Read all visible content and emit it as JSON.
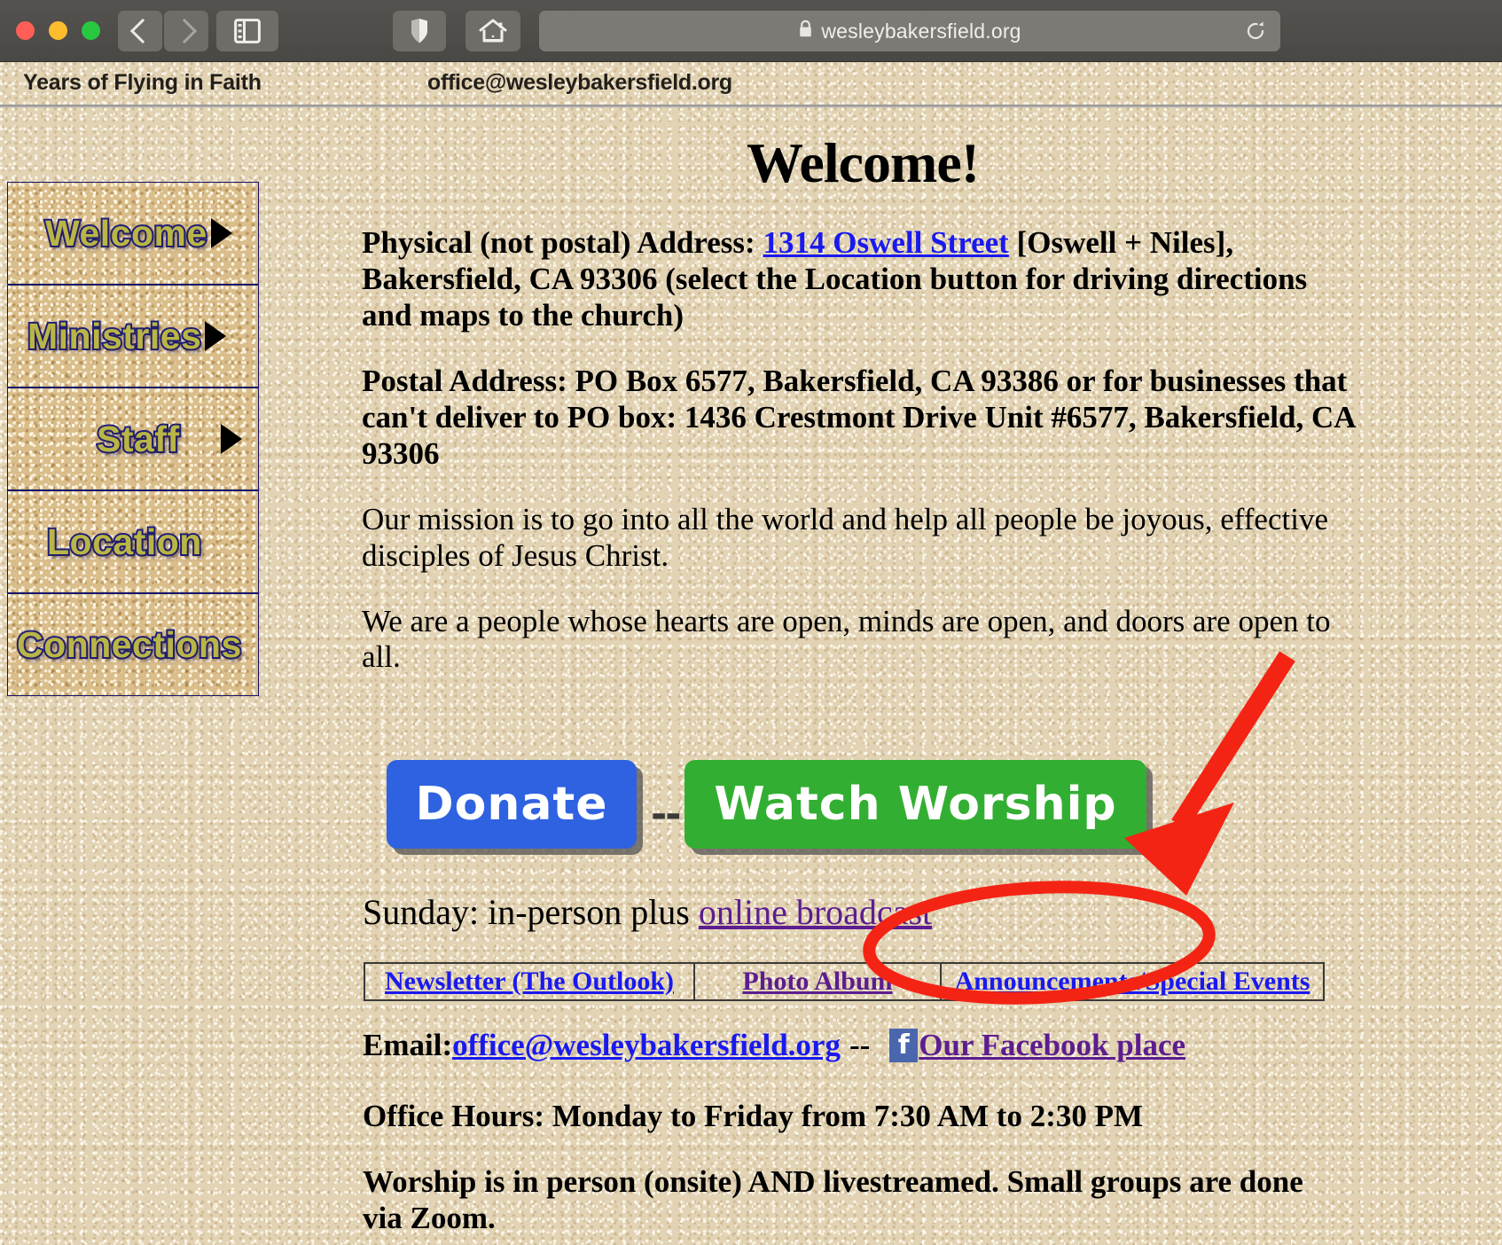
{
  "browser": {
    "url": "wesleybakersfield.org",
    "lock_icon": "lock-icon",
    "back_icon": "chevron-left-icon",
    "forward_icon": "chevron-right-icon",
    "sidebar_icon": "sidebar-icon",
    "privacy_icon": "shield-icon",
    "home_icon": "home-icon",
    "reload_icon": "reload-icon"
  },
  "header": {
    "tagline": "Years of Flying in Faith",
    "email": "office@wesleybakersfield.org"
  },
  "sidebar": {
    "items": [
      {
        "label": "Welcome",
        "has_arrow": true
      },
      {
        "label": "Ministries",
        "has_arrow": true
      },
      {
        "label": "Staff",
        "has_arrow": true
      },
      {
        "label": "Location",
        "has_arrow": false
      },
      {
        "label": "Connections",
        "has_arrow": false
      }
    ]
  },
  "main": {
    "title": "Welcome!",
    "physical_address": {
      "prefix": "Physical (not postal) Address: ",
      "link": "1314 Oswell Street",
      "suffix": " [Oswell + Niles], Bakersfield, CA 93306 (select the Location button for driving directions and maps to the church)"
    },
    "postal_address": "Postal Address: PO Box 6577, Bakersfield, CA 93386 or for businesses that can't deliver to PO box: 1436 Crestmont Drive Unit #6577, Bakersfield, CA 93306",
    "mission": "Our mission is to go into all the world and help all people be joyous, effective disciples of Jesus Christ.",
    "open_statement": "We are a people whose hearts are open, minds are open, and doors are open to all.",
    "donate_label": "Donate",
    "button_separator": "--",
    "watch_label": "Watch Worship",
    "sunday": {
      "prefix": "Sunday: in-person plus ",
      "link": "online broadcast"
    },
    "links_table": [
      {
        "label": "Newsletter (The Outlook)",
        "color": "blue"
      },
      {
        "label": "Photo Album",
        "color": "purple"
      },
      {
        "label": "Announcements/Special Events",
        "color": "blue"
      }
    ],
    "email_row": {
      "prefix": "Email: ",
      "email_link": "office@wesleybakersfield.org",
      "separator": "--",
      "fb_icon_glyph": "f",
      "fb_link": "Our Facebook place"
    },
    "office_hours": "Office Hours: Monday to Friday from 7:30 AM to 2:30 PM",
    "worship_note": "Worship is in person (onsite) AND livestreamed. Small groups are done via Zoom."
  },
  "annotations": {
    "arrow_color": "#f42414",
    "ellipse_color": "#f42414",
    "arrow_name": "red-arrow-annotation",
    "ellipse_name": "red-ellipse-annotation"
  },
  "colors": {
    "link_blue": "#1919ef",
    "link_purple": "#5c1d8f",
    "donate_blue": "#2f62e0",
    "watch_green": "#32af32",
    "nav_text": "#b9b546",
    "nav_outline": "#1f1f78",
    "page_bg": "#e2d3b4",
    "chrome_bg": "#4f4d49"
  }
}
